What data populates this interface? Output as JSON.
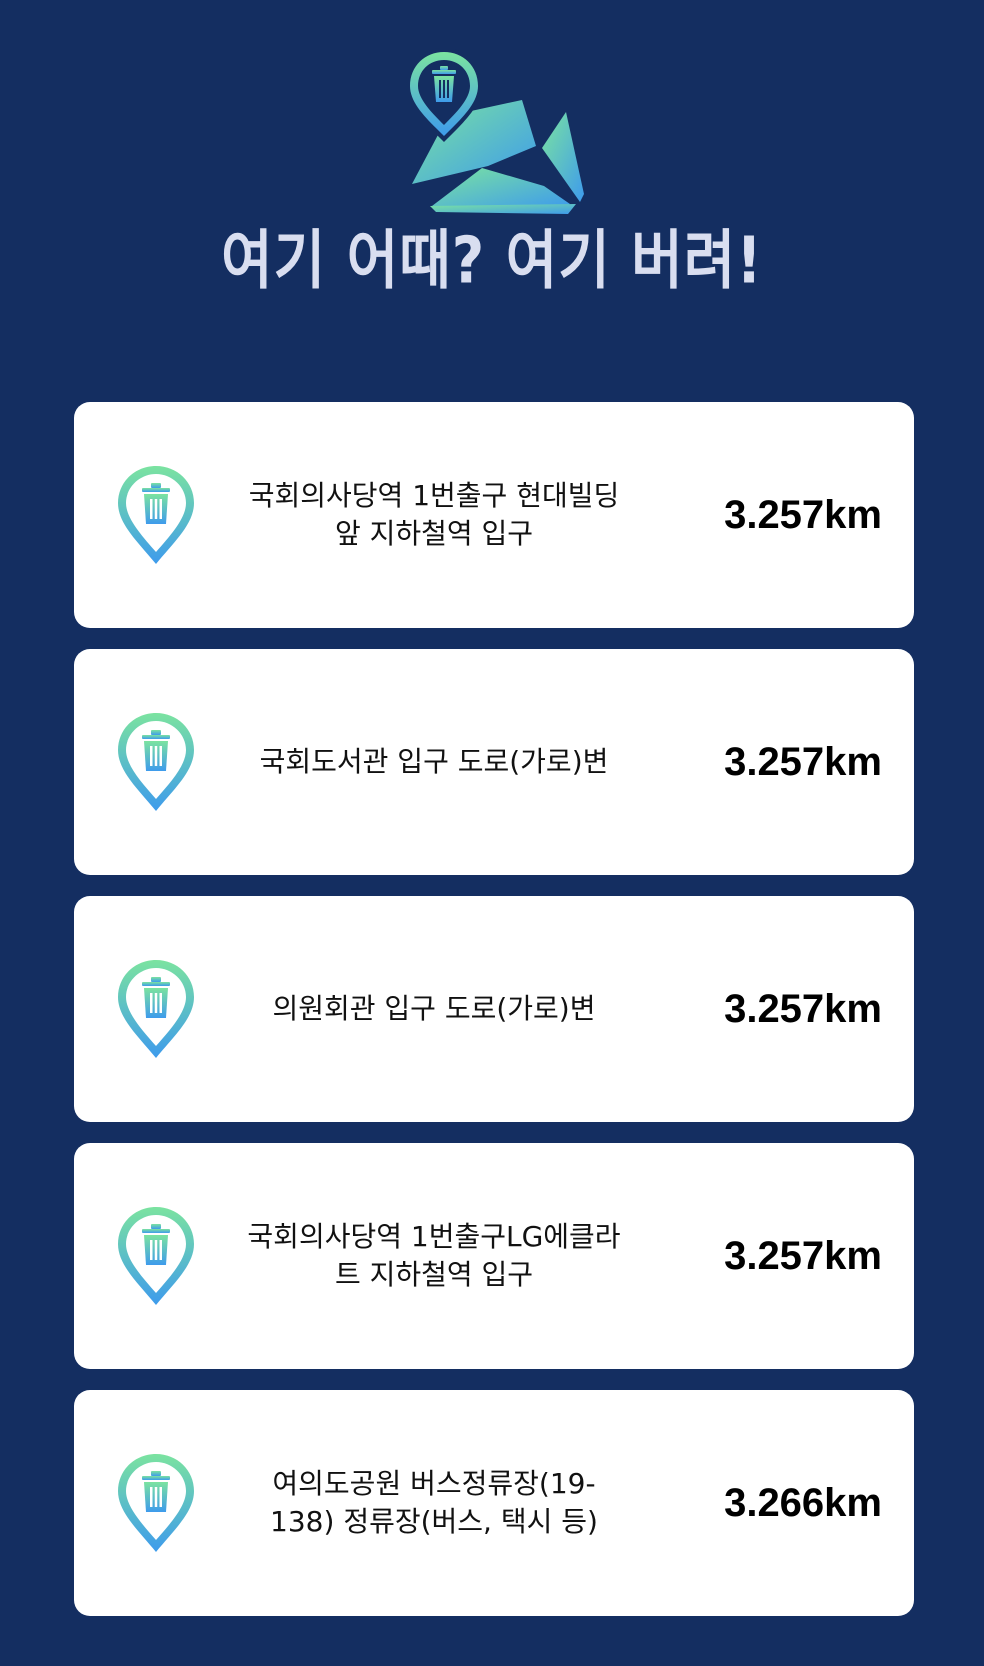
{
  "header": {
    "logo_icon": "folded-map-with-trash-pin-icon",
    "title": "여기 어때? 여기 버려!"
  },
  "colors": {
    "background": "#142e61",
    "card": "#ffffff",
    "gradient_start": "#7be3a0",
    "gradient_end": "#3e9bec",
    "title": "#d9def0"
  },
  "locations": [
    {
      "icon": "trash-pin-icon",
      "name": "국회의사당역 1번출구 현대빌딩 앞 지하철역 입구",
      "distance": "3.257km"
    },
    {
      "icon": "trash-pin-icon",
      "name": "국회도서관 입구 도로(가로)변",
      "distance": "3.257km"
    },
    {
      "icon": "trash-pin-icon",
      "name": "의원회관 입구 도로(가로)변",
      "distance": "3.257km"
    },
    {
      "icon": "trash-pin-icon",
      "name": "국회의사당역 1번출구LG에클라트 지하철역 입구",
      "distance": "3.257km"
    },
    {
      "icon": "trash-pin-icon",
      "name": "여의도공원 버스정류장(19-138) 정류장(버스, 택시 등)",
      "distance": "3.266km"
    }
  ]
}
